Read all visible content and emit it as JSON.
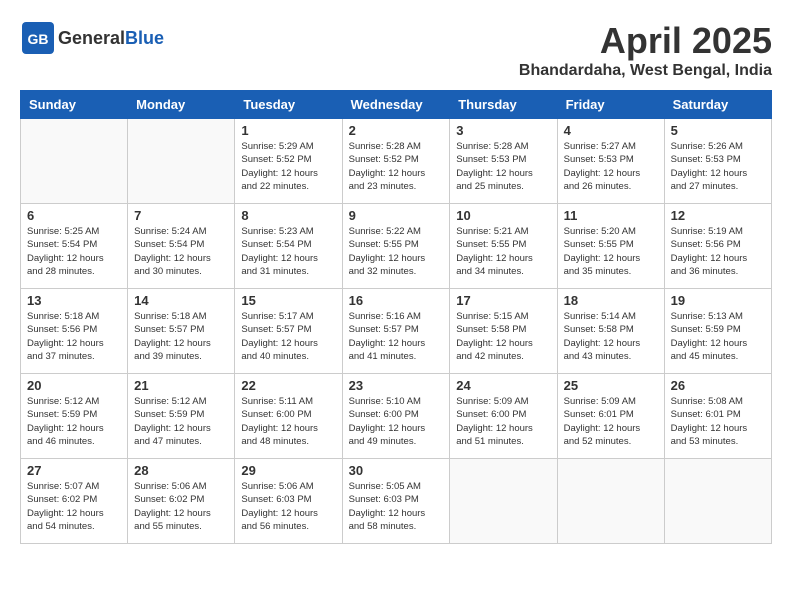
{
  "header": {
    "logo_general": "General",
    "logo_blue": "Blue",
    "month_title": "April 2025",
    "location": "Bhandardaha, West Bengal, India"
  },
  "days_of_week": [
    "Sunday",
    "Monday",
    "Tuesday",
    "Wednesday",
    "Thursday",
    "Friday",
    "Saturday"
  ],
  "weeks": [
    [
      {
        "day": "",
        "info": ""
      },
      {
        "day": "",
        "info": ""
      },
      {
        "day": "1",
        "info": "Sunrise: 5:29 AM\nSunset: 5:52 PM\nDaylight: 12 hours and 22 minutes."
      },
      {
        "day": "2",
        "info": "Sunrise: 5:28 AM\nSunset: 5:52 PM\nDaylight: 12 hours and 23 minutes."
      },
      {
        "day": "3",
        "info": "Sunrise: 5:28 AM\nSunset: 5:53 PM\nDaylight: 12 hours and 25 minutes."
      },
      {
        "day": "4",
        "info": "Sunrise: 5:27 AM\nSunset: 5:53 PM\nDaylight: 12 hours and 26 minutes."
      },
      {
        "day": "5",
        "info": "Sunrise: 5:26 AM\nSunset: 5:53 PM\nDaylight: 12 hours and 27 minutes."
      }
    ],
    [
      {
        "day": "6",
        "info": "Sunrise: 5:25 AM\nSunset: 5:54 PM\nDaylight: 12 hours and 28 minutes."
      },
      {
        "day": "7",
        "info": "Sunrise: 5:24 AM\nSunset: 5:54 PM\nDaylight: 12 hours and 30 minutes."
      },
      {
        "day": "8",
        "info": "Sunrise: 5:23 AM\nSunset: 5:54 PM\nDaylight: 12 hours and 31 minutes."
      },
      {
        "day": "9",
        "info": "Sunrise: 5:22 AM\nSunset: 5:55 PM\nDaylight: 12 hours and 32 minutes."
      },
      {
        "day": "10",
        "info": "Sunrise: 5:21 AM\nSunset: 5:55 PM\nDaylight: 12 hours and 34 minutes."
      },
      {
        "day": "11",
        "info": "Sunrise: 5:20 AM\nSunset: 5:55 PM\nDaylight: 12 hours and 35 minutes."
      },
      {
        "day": "12",
        "info": "Sunrise: 5:19 AM\nSunset: 5:56 PM\nDaylight: 12 hours and 36 minutes."
      }
    ],
    [
      {
        "day": "13",
        "info": "Sunrise: 5:18 AM\nSunset: 5:56 PM\nDaylight: 12 hours and 37 minutes."
      },
      {
        "day": "14",
        "info": "Sunrise: 5:18 AM\nSunset: 5:57 PM\nDaylight: 12 hours and 39 minutes."
      },
      {
        "day": "15",
        "info": "Sunrise: 5:17 AM\nSunset: 5:57 PM\nDaylight: 12 hours and 40 minutes."
      },
      {
        "day": "16",
        "info": "Sunrise: 5:16 AM\nSunset: 5:57 PM\nDaylight: 12 hours and 41 minutes."
      },
      {
        "day": "17",
        "info": "Sunrise: 5:15 AM\nSunset: 5:58 PM\nDaylight: 12 hours and 42 minutes."
      },
      {
        "day": "18",
        "info": "Sunrise: 5:14 AM\nSunset: 5:58 PM\nDaylight: 12 hours and 43 minutes."
      },
      {
        "day": "19",
        "info": "Sunrise: 5:13 AM\nSunset: 5:59 PM\nDaylight: 12 hours and 45 minutes."
      }
    ],
    [
      {
        "day": "20",
        "info": "Sunrise: 5:12 AM\nSunset: 5:59 PM\nDaylight: 12 hours and 46 minutes."
      },
      {
        "day": "21",
        "info": "Sunrise: 5:12 AM\nSunset: 5:59 PM\nDaylight: 12 hours and 47 minutes."
      },
      {
        "day": "22",
        "info": "Sunrise: 5:11 AM\nSunset: 6:00 PM\nDaylight: 12 hours and 48 minutes."
      },
      {
        "day": "23",
        "info": "Sunrise: 5:10 AM\nSunset: 6:00 PM\nDaylight: 12 hours and 49 minutes."
      },
      {
        "day": "24",
        "info": "Sunrise: 5:09 AM\nSunset: 6:00 PM\nDaylight: 12 hours and 51 minutes."
      },
      {
        "day": "25",
        "info": "Sunrise: 5:09 AM\nSunset: 6:01 PM\nDaylight: 12 hours and 52 minutes."
      },
      {
        "day": "26",
        "info": "Sunrise: 5:08 AM\nSunset: 6:01 PM\nDaylight: 12 hours and 53 minutes."
      }
    ],
    [
      {
        "day": "27",
        "info": "Sunrise: 5:07 AM\nSunset: 6:02 PM\nDaylight: 12 hours and 54 minutes."
      },
      {
        "day": "28",
        "info": "Sunrise: 5:06 AM\nSunset: 6:02 PM\nDaylight: 12 hours and 55 minutes."
      },
      {
        "day": "29",
        "info": "Sunrise: 5:06 AM\nSunset: 6:03 PM\nDaylight: 12 hours and 56 minutes."
      },
      {
        "day": "30",
        "info": "Sunrise: 5:05 AM\nSunset: 6:03 PM\nDaylight: 12 hours and 58 minutes."
      },
      {
        "day": "",
        "info": ""
      },
      {
        "day": "",
        "info": ""
      },
      {
        "day": "",
        "info": ""
      }
    ]
  ]
}
